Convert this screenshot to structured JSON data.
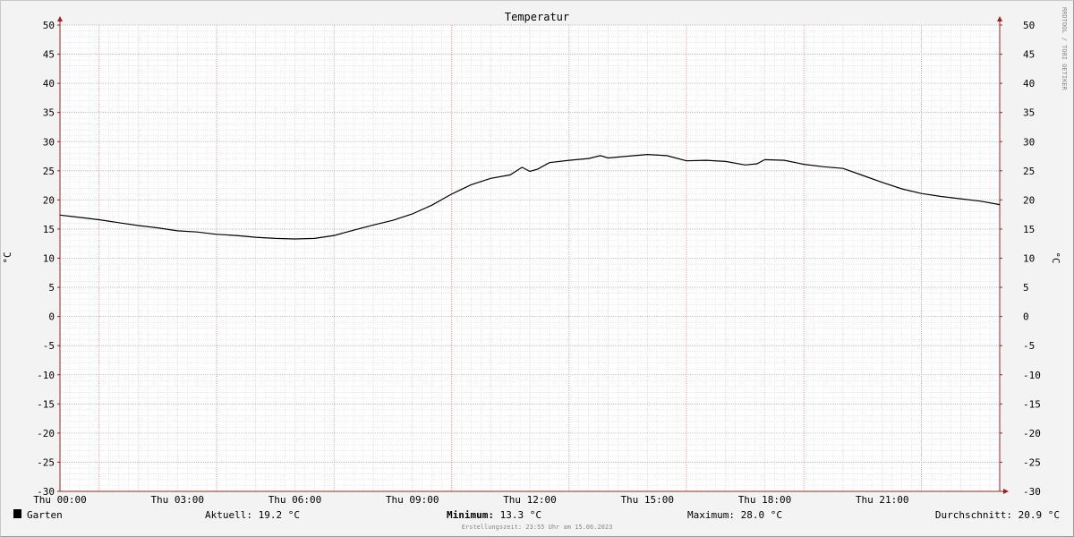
{
  "chart_data": {
    "type": "line",
    "title": "Temperatur",
    "ylabel_left": "°C",
    "ylabel_right": "°C",
    "ylim": [
      -30,
      50
    ],
    "yticks": [
      "50",
      "45",
      "40",
      "35",
      "30",
      "25",
      "20",
      "15",
      "10",
      "5",
      "0",
      "-5",
      "-10",
      "-15",
      "-20",
      "-25",
      "-30"
    ],
    "xlim_hours": [
      0,
      24
    ],
    "xticks": [
      {
        "h": 0,
        "label": "Thu 00:00"
      },
      {
        "h": 3,
        "label": "Thu 03:00"
      },
      {
        "h": 6,
        "label": "Thu 06:00"
      },
      {
        "h": 9,
        "label": "Thu 09:00"
      },
      {
        "h": 12,
        "label": "Thu 12:00"
      },
      {
        "h": 15,
        "label": "Thu 15:00"
      },
      {
        "h": 18,
        "label": "Thu 18:00"
      },
      {
        "h": 21,
        "label": "Thu 21:00"
      }
    ],
    "grid": true,
    "series": [
      {
        "name": "Garten",
        "color": "#000000",
        "hours": [
          0,
          0.5,
          1,
          1.5,
          2,
          2.5,
          3,
          3.5,
          4,
          4.5,
          5,
          5.5,
          6,
          6.5,
          7,
          7.5,
          8,
          8.5,
          9,
          9.5,
          10,
          10.5,
          11,
          11.5,
          11.8,
          12,
          12.2,
          12.5,
          13,
          13.5,
          13.8,
          14,
          14.5,
          15,
          15.5,
          16,
          16.5,
          17,
          17.5,
          17.8,
          18,
          18.5,
          19,
          19.5,
          20,
          20.5,
          21,
          21.5,
          22,
          22.5,
          23,
          23.5,
          24
        ],
        "values": [
          17.4,
          17.0,
          16.6,
          16.1,
          15.6,
          15.2,
          14.7,
          14.5,
          14.1,
          13.9,
          13.6,
          13.4,
          13.3,
          13.4,
          13.9,
          14.8,
          15.7,
          16.5,
          17.6,
          19.1,
          21.0,
          22.6,
          23.7,
          24.3,
          25.6,
          24.9,
          25.3,
          26.4,
          26.8,
          27.1,
          27.6,
          27.2,
          27.5,
          27.8,
          27.6,
          26.7,
          26.8,
          26.6,
          26.0,
          26.2,
          26.9,
          26.8,
          26.1,
          25.7,
          25.4,
          24.2,
          23.0,
          21.9,
          21.1,
          20.6,
          20.2,
          19.8,
          19.2
        ]
      }
    ]
  },
  "legend": {
    "series_name": "Garten",
    "series_color": "#000000",
    "current": "Aktuell: 19.2 °C",
    "minimum_label": "Minimum:",
    "minimum_value": " 13.3 °C",
    "maximum": "Maximum: 28.0 °C",
    "average": "Durchschnitt: 20.9 °C"
  },
  "footer": "Erstellungszeit: 23:55 Uhr am 15.06.2023",
  "watermark": "RRDTOOL / TOBI OETIKER",
  "colors": {
    "background": "#f3f3f3",
    "canvas": "#ffffff",
    "major_grid": "#e8a0a0",
    "minor_grid": "#d7d7d7",
    "axis_arrow": "#a02020"
  }
}
